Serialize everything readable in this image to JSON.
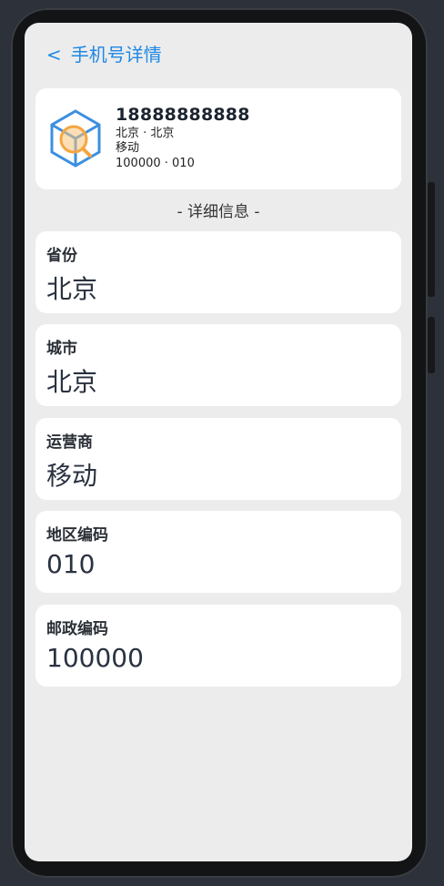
{
  "header": {
    "back_symbol": "<",
    "title": "手机号详情"
  },
  "summary": {
    "number": "18888888888",
    "location": "北京 · 北京",
    "carrier": "移动",
    "codes": "100000 · 010"
  },
  "section_title": "- 详细信息 -",
  "fields": [
    {
      "label": "省份",
      "value": "北京"
    },
    {
      "label": "城市",
      "value": "北京"
    },
    {
      "label": "运营商",
      "value": "移动"
    },
    {
      "label": "地区编码",
      "value": "010"
    },
    {
      "label": "邮政编码",
      "value": "100000"
    }
  ],
  "colors": {
    "accent": "#1e88e5",
    "logo_blue": "#3b8fe0",
    "logo_orange": "#f5a640"
  }
}
